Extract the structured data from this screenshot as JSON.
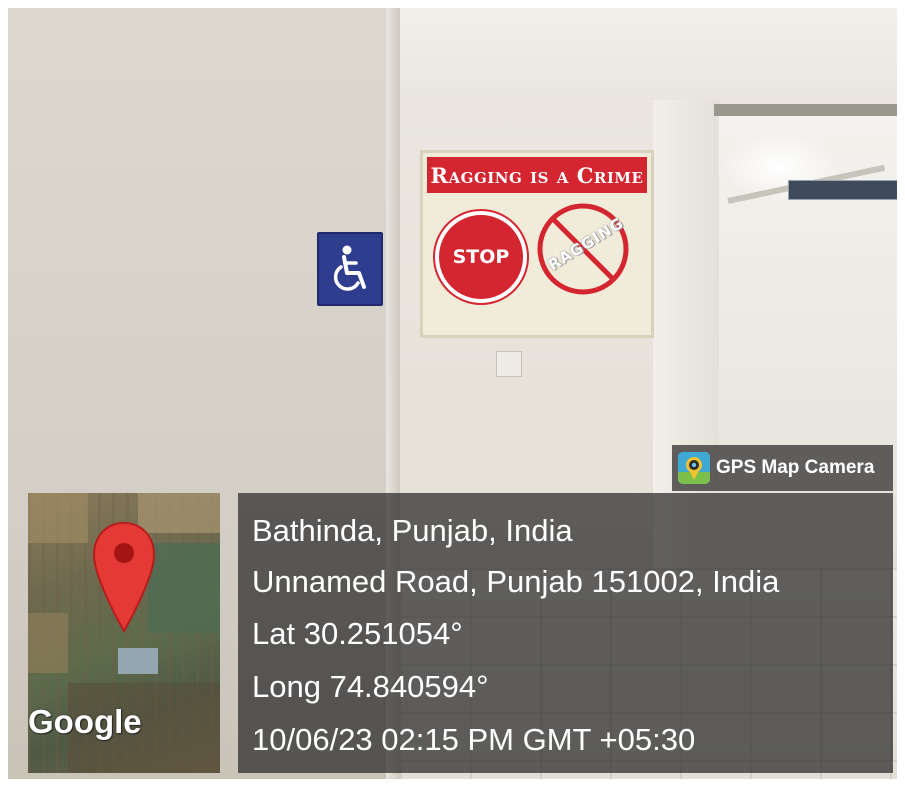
{
  "poster": {
    "title": "Ragging is a Crime",
    "stop_text": "STOP",
    "no_text": "RAGGING"
  },
  "overlay": {
    "app_name": "GPS Map Camera",
    "map_logo": "Google",
    "city": "Bathinda, Punjab, India",
    "address": "Unnamed Road, Punjab 151002, India",
    "lat": "Lat 30.251054°",
    "long": "Long 74.840594°",
    "datetime": "10/06/23 02:15 PM GMT +05:30"
  },
  "icons": {
    "accessibility": "wheelchair-icon",
    "app": "gps-map-camera-icon",
    "pin": "map-pin-icon"
  },
  "colors": {
    "poster_red": "#d42631",
    "access_blue": "#2f3d8f",
    "overlay_bg": "#282828",
    "pin_red": "#e53935"
  }
}
